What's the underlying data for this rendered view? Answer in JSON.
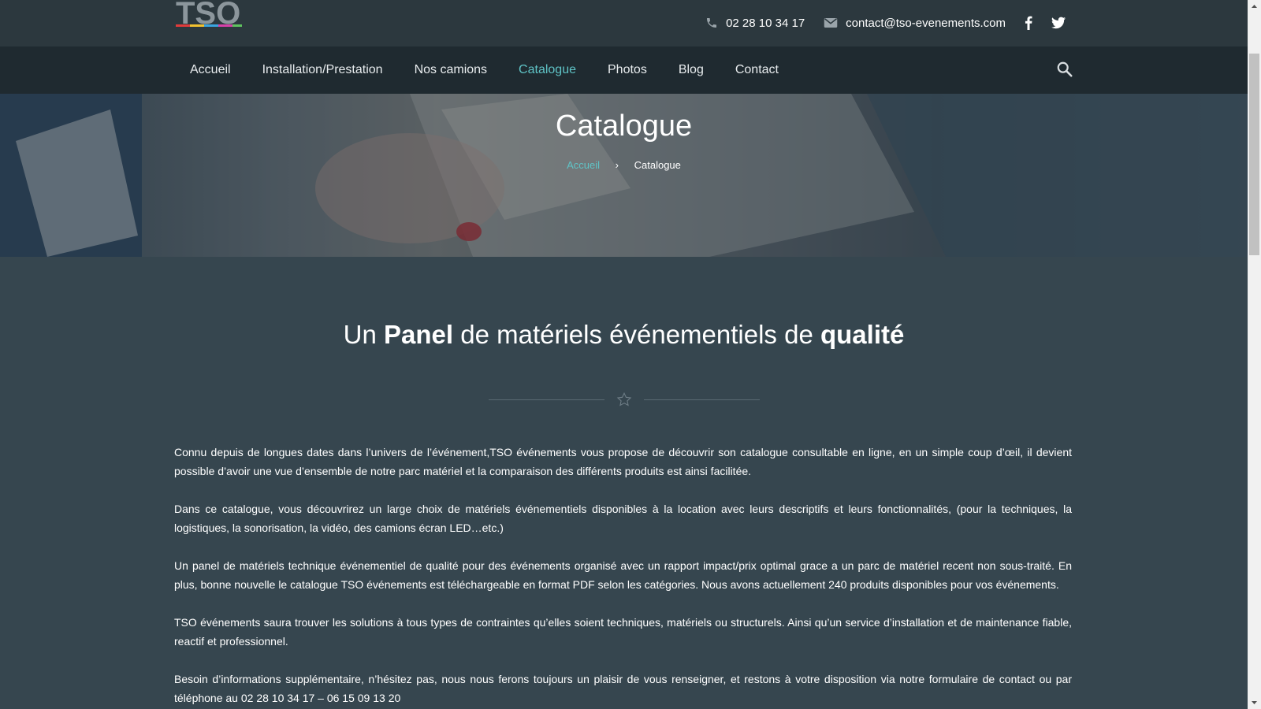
{
  "header": {
    "logo_text": "TSO",
    "phone": "02 28 10 34 17",
    "email": "contact@tso-evenements.com"
  },
  "nav": {
    "items": [
      {
        "label": "Accueil"
      },
      {
        "label": "Installation/Prestation"
      },
      {
        "label": "Nos camions"
      },
      {
        "label": "Catalogue",
        "active": true
      },
      {
        "label": "Photos"
      },
      {
        "label": "Blog"
      },
      {
        "label": "Contact"
      }
    ]
  },
  "hero": {
    "title": "Catalogue",
    "breadcrumb": {
      "home": "Accueil",
      "separator": "›",
      "current": "Catalogue"
    }
  },
  "content": {
    "heading": {
      "part1": "Un ",
      "bold1": "Panel",
      "part2": " de matériels événementiels de ",
      "bold2": "qualité"
    },
    "paragraphs": [
      "Connu depuis de longues dates dans l’univers de l’événement,TSO événements vous propose de découvrir son catalogue consultable en ligne, en un simple coup d’œil, il devient possible d’avoir une vue d’ensemble de notre parc matériel et la comparaison des différents produits est ainsi facilitée.",
      "Dans ce catalogue, vous découvrirez un large choix de matériels événementiels disponibles à la location avec leurs descriptifs et leurs fonctionnalités, (pour  la techniques, la logistiques, la sonorisation, la vidéo, des camions écran LED…etc.)",
      "Un panel de matériels technique événementiel de qualité pour des événements organisé avec un rapport impact/prix optimal grace a un parc de matériel recent non sous-traité. En plus, bonne nouvelle le catalogue TSO événements est téléchargeable en format PDF selon les catégories. Nous avons actuellement 240 produits disponibles pour vos événements.",
      "TSO événements saura trouver les solutions à tous types de contraintes qu’elles soient techniques, matériels ou structurels. Ainsi qu’un service d’installation et de maintenance fiable, reactif et professionnel.",
      "Besoin d’informations supplémentaire, n’hésitez pas, nous nous ferons toujours un plaisir de vous renseigner, et restons à votre disposition via notre formulaire de contact ou par téléphone au 02 28 10 34 17 –  06 15 09 13 20"
    ]
  },
  "colors": {
    "accent": "#5fc3c6",
    "topbar": "#2c383e",
    "navbar": "#1f2a30",
    "body": "#36464f"
  }
}
